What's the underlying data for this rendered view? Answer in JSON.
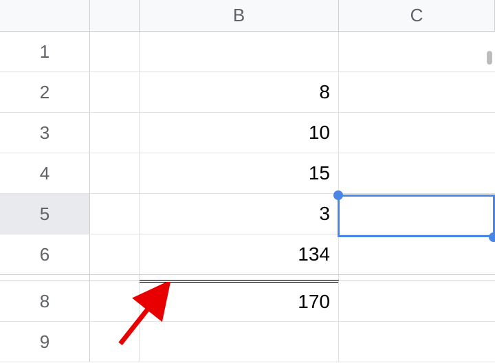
{
  "columns": {
    "b": "B",
    "c": "C"
  },
  "rows": {
    "r1": "1",
    "r2": "2",
    "r3": "3",
    "r4": "4",
    "r5": "5",
    "r6": "6",
    "r8": "8",
    "r9": "9"
  },
  "cells": {
    "b2": "8",
    "b3": "10",
    "b4": "15",
    "b5": "3",
    "b6": "134",
    "b8": "170"
  },
  "selection": {
    "cell": "C5",
    "row_active": "5"
  },
  "annotation": {
    "arrow_color": "#e80000",
    "points_to": "double-border-b8"
  },
  "chart_data": {
    "type": "table",
    "rows": [
      {
        "row": 1,
        "B": null
      },
      {
        "row": 2,
        "B": 8
      },
      {
        "row": 3,
        "B": 10
      },
      {
        "row": 4,
        "B": 15
      },
      {
        "row": 5,
        "B": 3
      },
      {
        "row": 6,
        "B": 134
      },
      {
        "row": 8,
        "B": 170
      }
    ],
    "notes": "Row 7 hidden; B8 has double top border (likely a total); C5 is the selected cell"
  }
}
